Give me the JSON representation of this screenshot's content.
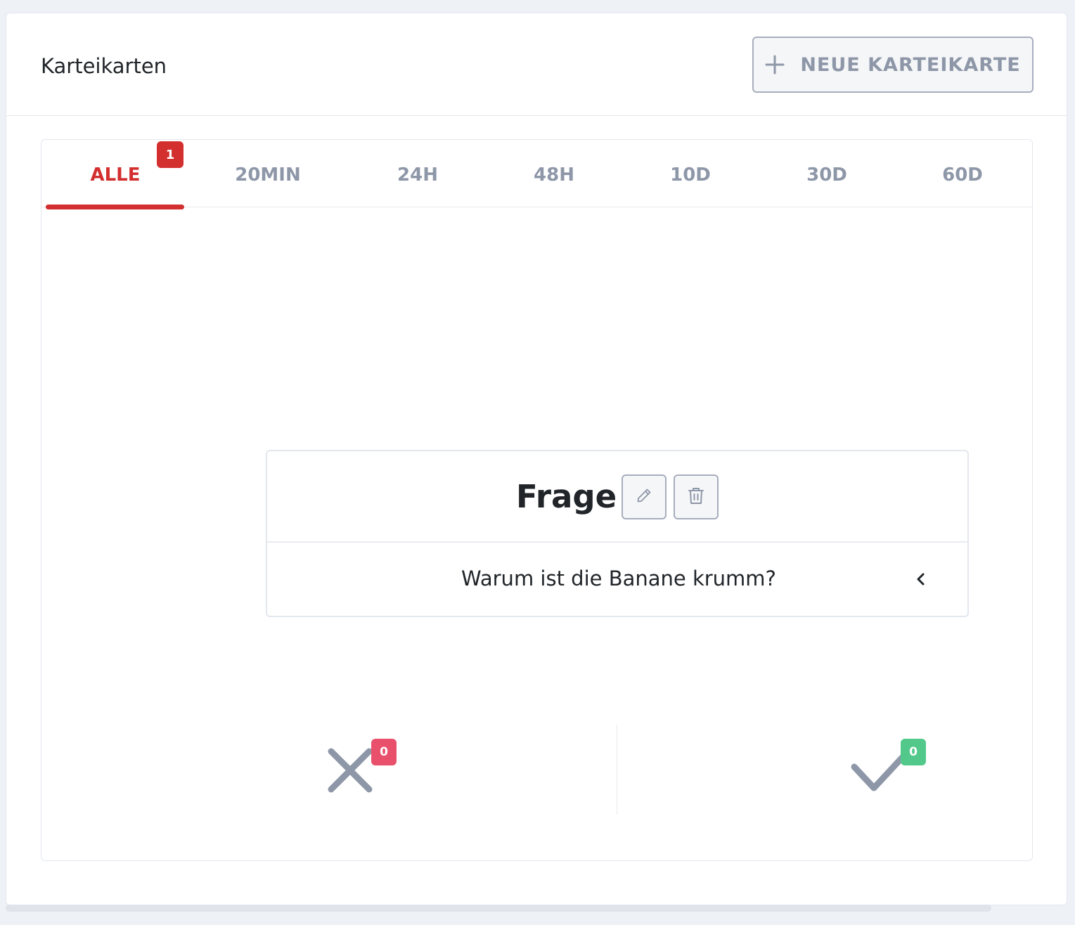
{
  "header": {
    "title": "Karteikarten",
    "new_button_label": "NEUE KARTEIKARTE"
  },
  "tabs": [
    {
      "label": "ALLE",
      "active": true,
      "badge": "1"
    },
    {
      "label": "20MIN"
    },
    {
      "label": "24H"
    },
    {
      "label": "48H"
    },
    {
      "label": "10D"
    },
    {
      "label": "30D"
    },
    {
      "label": "60D"
    }
  ],
  "flashcard": {
    "title": "Frage",
    "question": "Warum ist die Banane krumm?"
  },
  "answers": {
    "wrong_count": "0",
    "right_count": "0"
  },
  "colors": {
    "accent": "#d32f2f",
    "muted": "#8e97a8",
    "wrong_badge": "#e9506b",
    "right_badge": "#52c98a"
  },
  "icons": {
    "add": "plus-icon",
    "edit": "pencil-icon",
    "delete": "trash-icon",
    "toggle": "chevron-left-icon",
    "wrong": "x-icon",
    "right": "check-icon"
  }
}
